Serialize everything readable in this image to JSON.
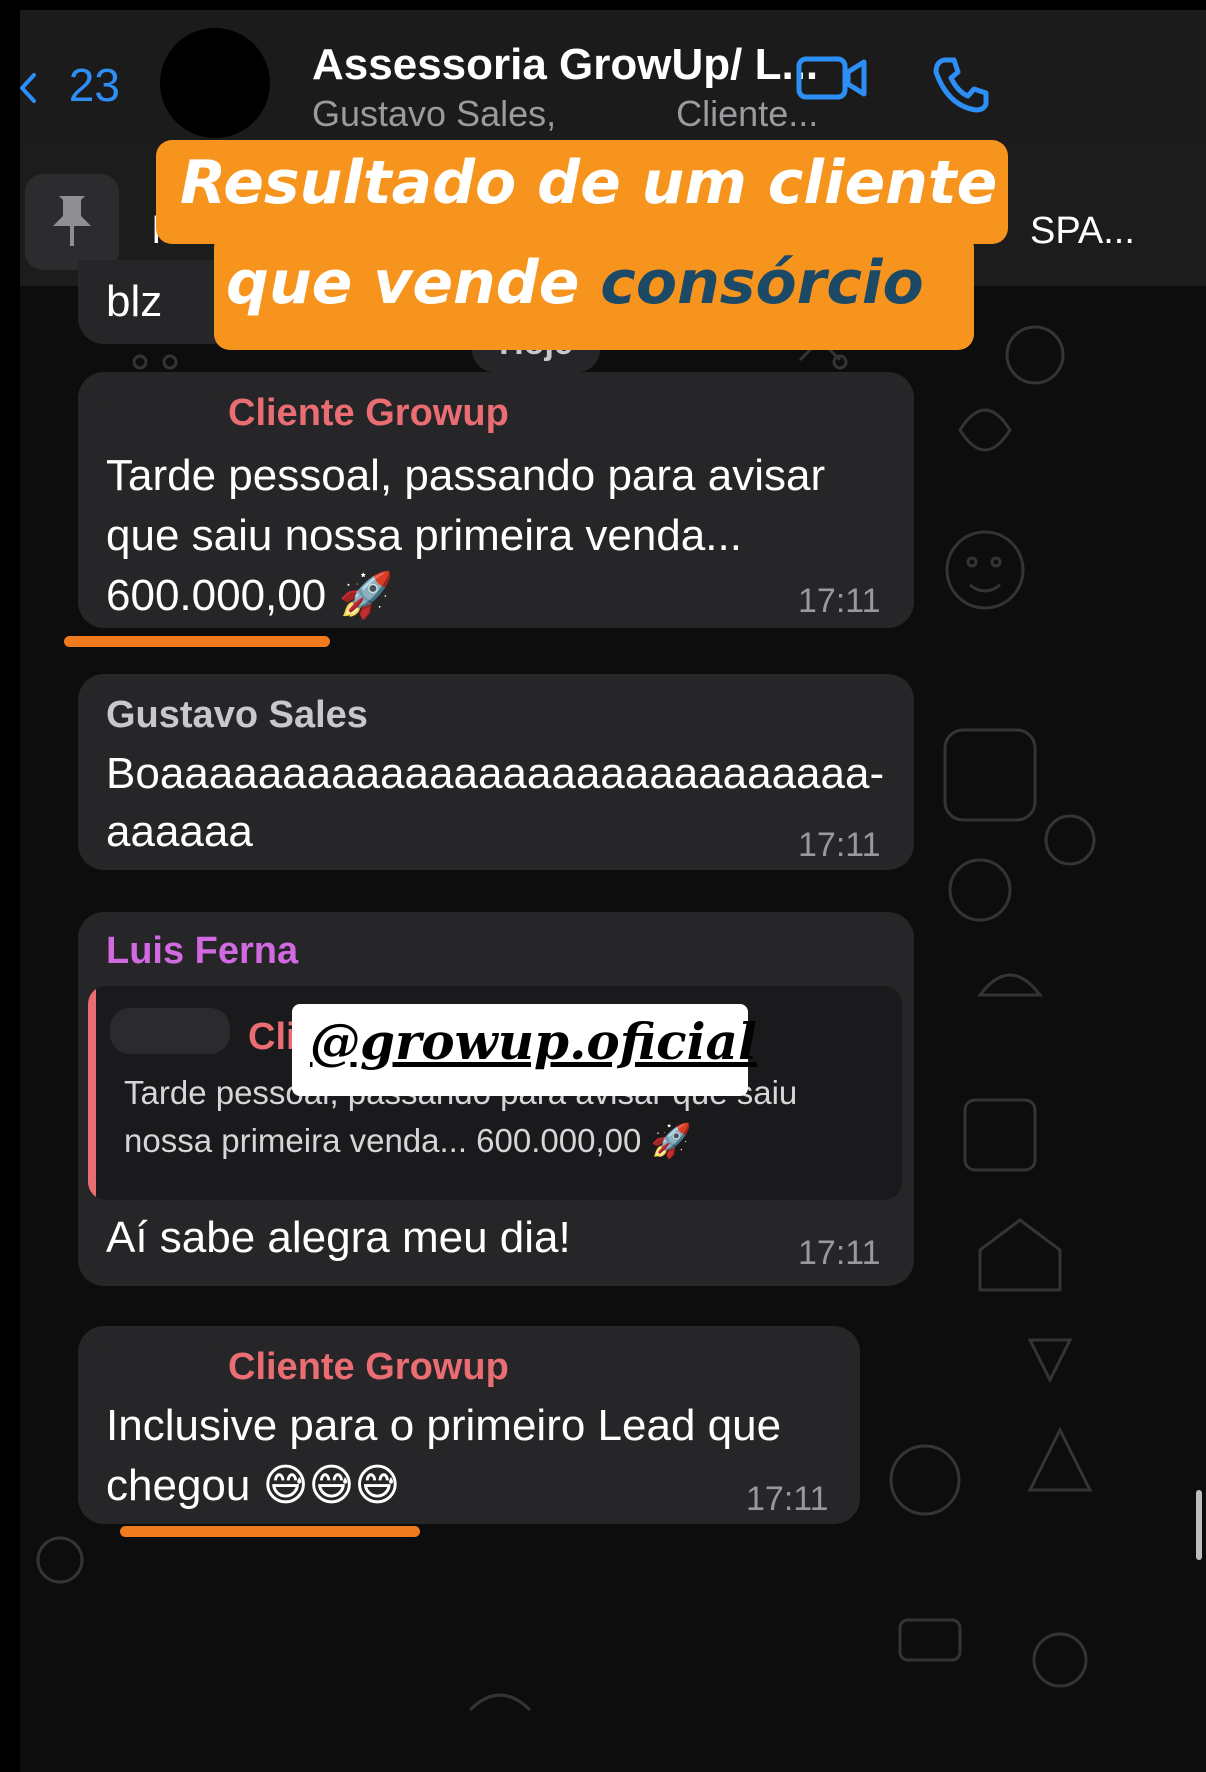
{
  "header": {
    "back_count": "23",
    "title": "Assessoria GrowUp/ L...",
    "subtitle_left": "Gustavo Sales,",
    "subtitle_right": "Cliente..."
  },
  "pinned": {
    "text": "h",
    "tail": "SPA..."
  },
  "banner": {
    "line1": "Resultado de um cliente",
    "line2_plain": "que vende ",
    "line2_highlight": "consórcio"
  },
  "chat": {
    "prev_message": "blz",
    "date_separator": "Hoje",
    "messages": [
      {
        "sender": "Cliente Growup",
        "lines": [
          "Tarde pessoal, passando para avisar",
          "que saiu nossa primeira venda...",
          "600.000,00 🚀"
        ],
        "time": "17:11"
      },
      {
        "sender": "Gustavo Sales",
        "lines": [
          "Boaaaaaaaaaaaaaaaaaaaaaaaaaaaaa-",
          "aaaaaa"
        ],
        "time": "17:11"
      },
      {
        "sender": "Luis Ferna",
        "quote_sender": "Cliente Growup",
        "quote_lines": [
          "Tarde pessoal, passando para avisar que saiu",
          "nossa primeira venda... 600.000,00 🚀"
        ],
        "lines": [
          "Aí sabe alegra meu dia!"
        ],
        "time": "17:11"
      },
      {
        "sender": "Cliente Growup",
        "lines": [
          "Inclusive para o primeiro Lead que",
          "chegou 😅😅😅"
        ],
        "time": "17:11"
      }
    ]
  },
  "overlay_handle": "@growup.oficial",
  "colors": {
    "accent_blue": "#2d8ef5",
    "banner_orange": "#f7941d",
    "banner_highlight": "#1c4966",
    "sender_red": "#ea6d73",
    "sender_gray": "#c7c7cc",
    "sender_purple": "#d16ae0"
  },
  "icons": [
    "chevron-left-icon",
    "video-call-icon",
    "phone-icon",
    "pin-icon"
  ]
}
